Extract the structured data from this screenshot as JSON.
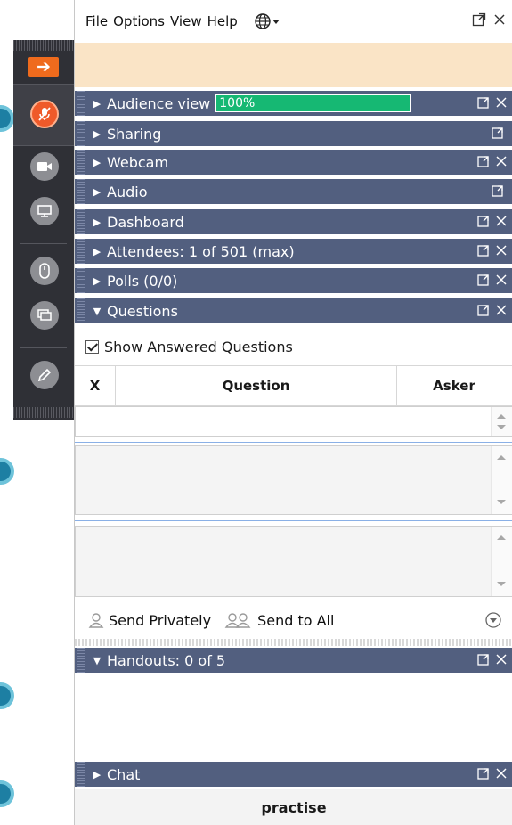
{
  "menu": {
    "items": [
      "File",
      "Options",
      "View",
      "Help"
    ],
    "language_icon": "globe-icon"
  },
  "panes": [
    {
      "title": "Audience view",
      "expanded": false,
      "progress": 100,
      "progress_label": "100%",
      "popout": true,
      "close": true
    },
    {
      "title": "Sharing",
      "expanded": false,
      "popout": true,
      "close": false
    },
    {
      "title": "Webcam",
      "expanded": false,
      "popout": true,
      "close": true
    },
    {
      "title": "Audio",
      "expanded": false,
      "popout": true,
      "close": false
    },
    {
      "title": "Dashboard",
      "expanded": false,
      "popout": true,
      "close": true
    },
    {
      "title": "Attendees: 1 of 501 (max)",
      "expanded": false,
      "popout": true,
      "close": true
    },
    {
      "title": "Polls (0/0)",
      "expanded": false,
      "popout": true,
      "close": true
    },
    {
      "title": "Questions",
      "expanded": true,
      "popout": true,
      "close": true
    }
  ],
  "questions": {
    "show_answered_label": "Show Answered Questions",
    "show_answered_checked": true,
    "columns": {
      "x": "X",
      "question": "Question",
      "asker": "Asker"
    },
    "send_privately_label": "Send Privately",
    "send_all_label": "Send to All"
  },
  "handouts": {
    "title": "Handouts: 0 of 5",
    "expanded": true
  },
  "chat": {
    "title": "Chat",
    "expanded": false,
    "footer_label": "practise"
  },
  "colors": {
    "pane_bar": "#525f7f",
    "progress_fill": "#16b873",
    "notice_bg": "#fae4c6",
    "toolbar_bg": "#2f3036",
    "accent_orange": "#ef6b1d"
  }
}
